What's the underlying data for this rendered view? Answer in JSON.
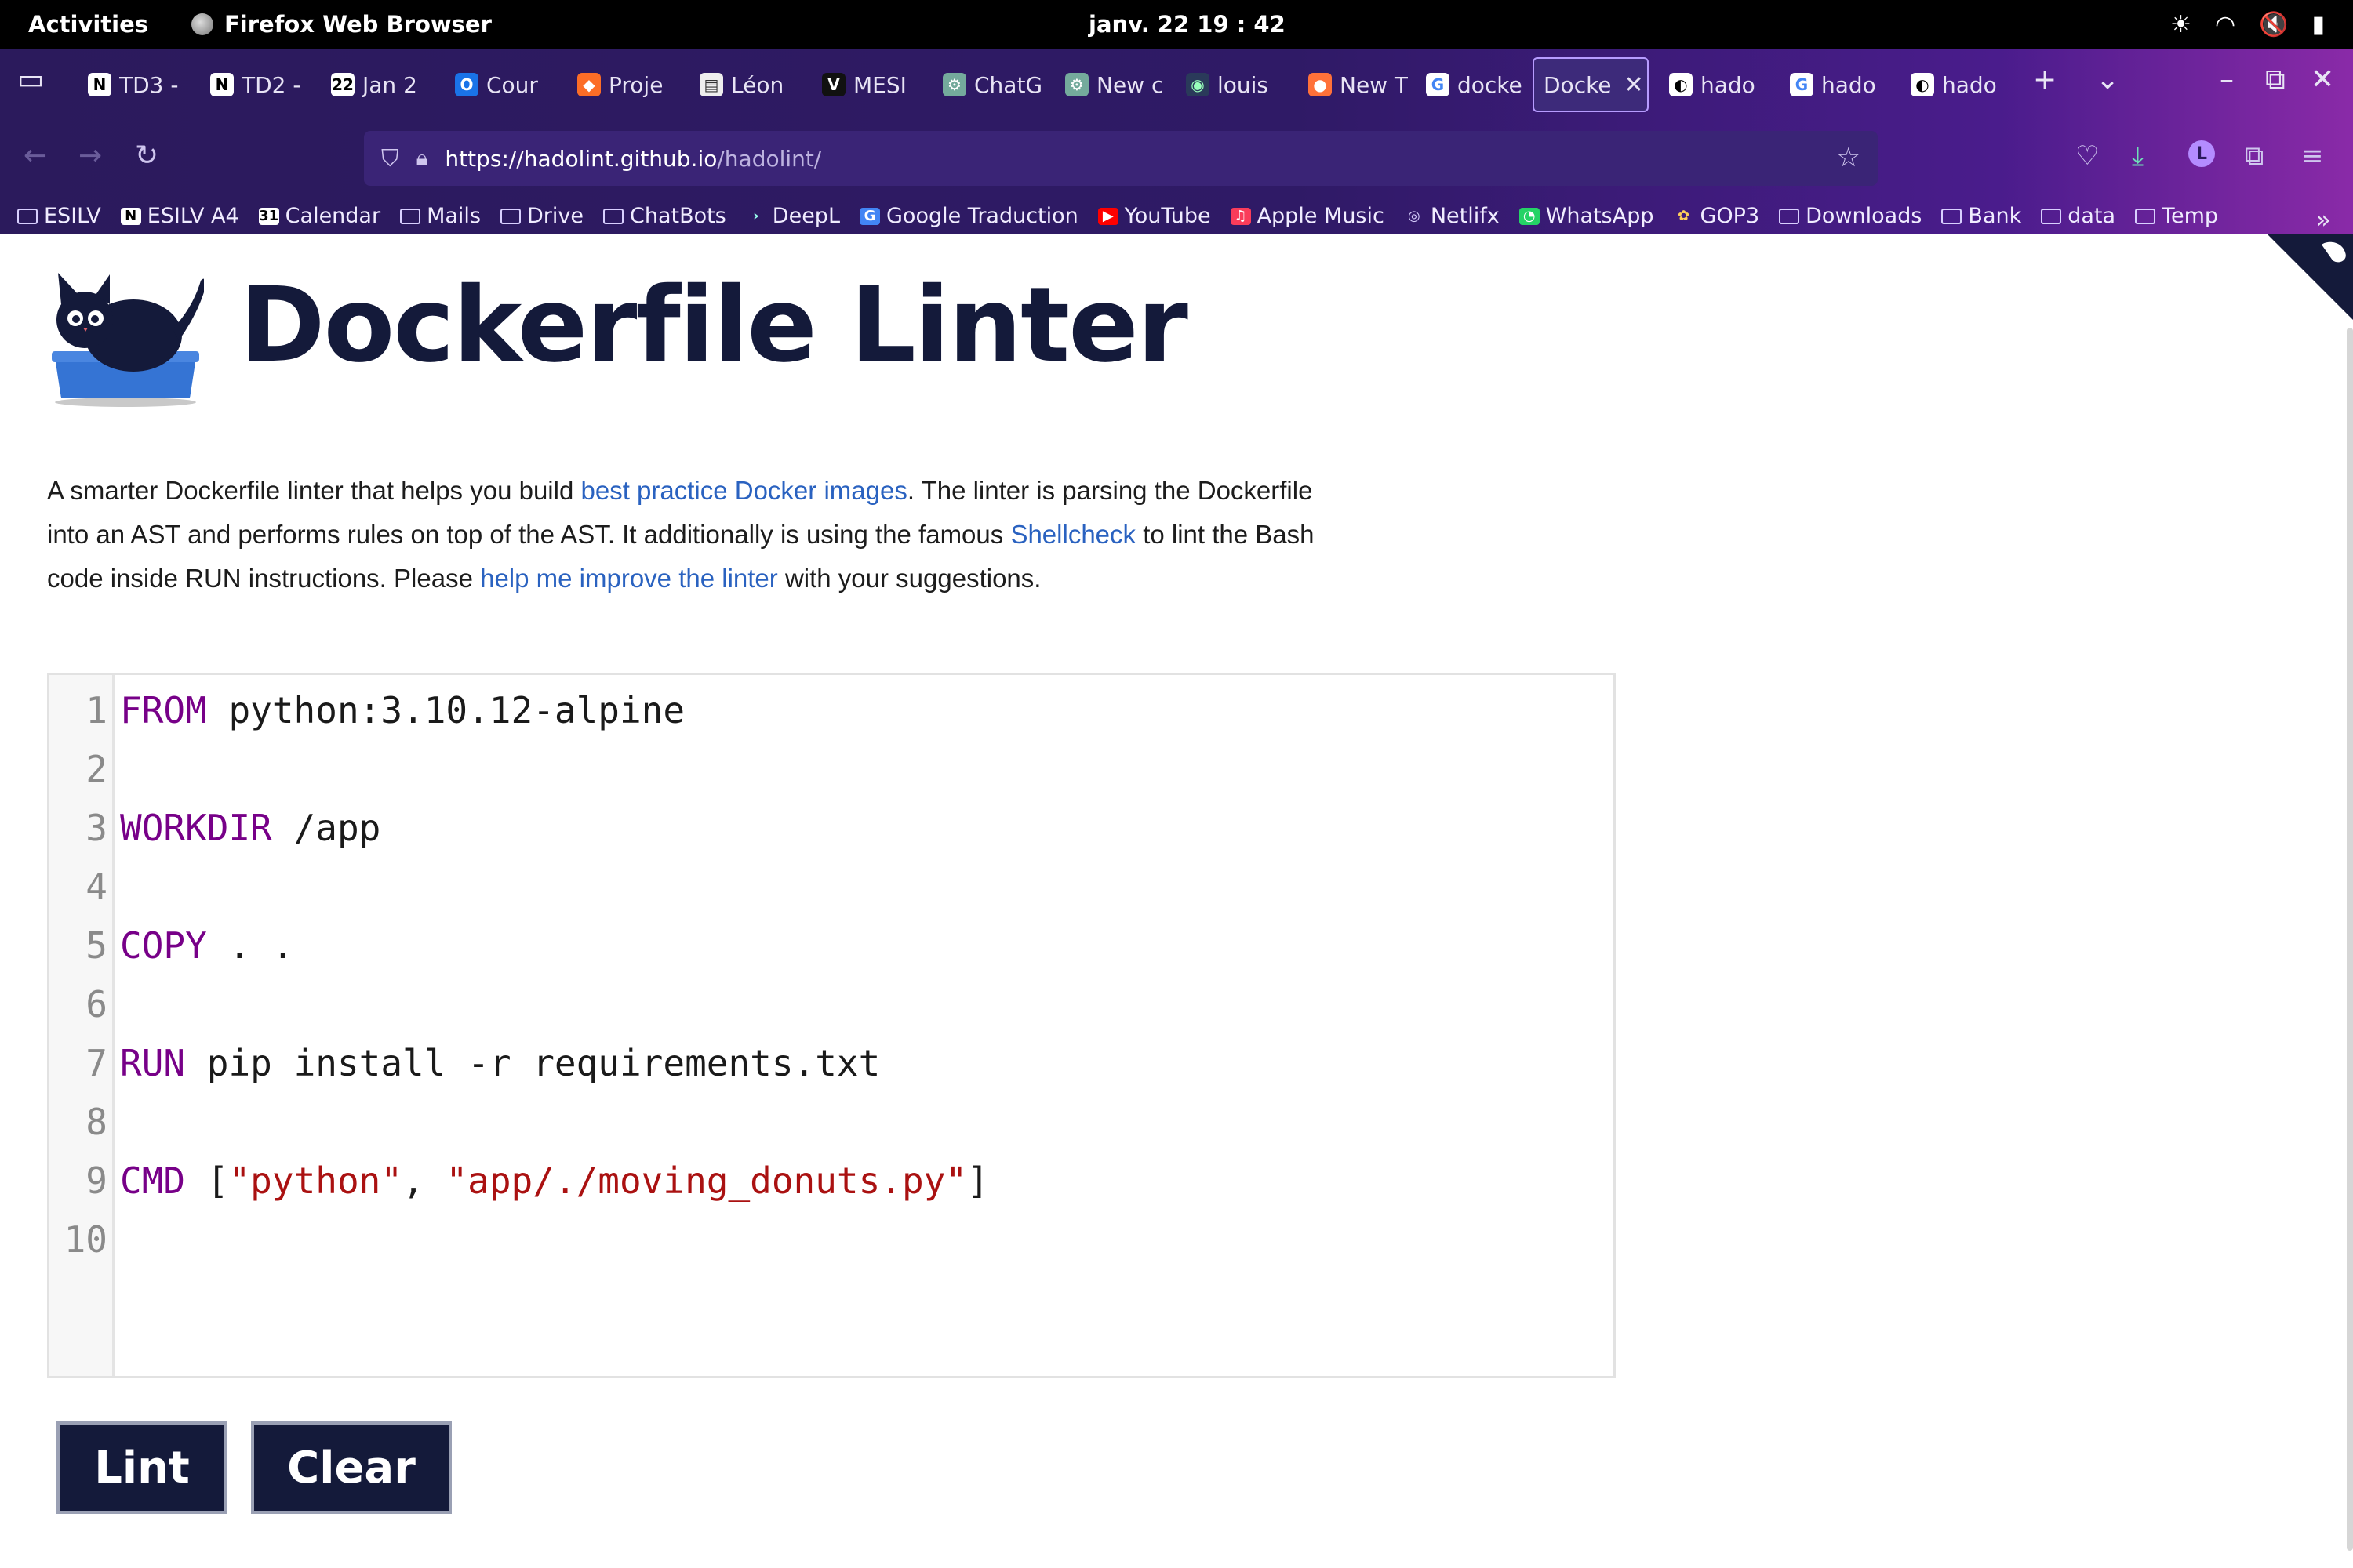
{
  "system_bar": {
    "activities": "Activities",
    "app_name": "Firefox Web Browser",
    "clock": "janv. 22  19 : 42"
  },
  "tabs": [
    {
      "label": "TD3 -",
      "icon": "notion-icon"
    },
    {
      "label": "TD2 -",
      "icon": "notion-icon"
    },
    {
      "label": "Jan 2",
      "icon": "calendar-icon"
    },
    {
      "label": "Cour",
      "icon": "outlook-icon"
    },
    {
      "label": "Proje",
      "icon": "gitlab-icon"
    },
    {
      "label": "Léon",
      "icon": "page-icon"
    },
    {
      "label": "MESI",
      "icon": "v-icon"
    },
    {
      "label": "ChatG",
      "icon": "openai-icon"
    },
    {
      "label": "New c",
      "icon": "openai-icon"
    },
    {
      "label": "louis",
      "icon": "globe-icon"
    },
    {
      "label": "New T",
      "icon": "firefox-icon"
    },
    {
      "label": "docke",
      "icon": "google-icon"
    },
    {
      "label": "Docke",
      "icon": "docker-icon",
      "active": true
    },
    {
      "label": "hado",
      "icon": "github-icon"
    },
    {
      "label": "hado",
      "icon": "google-icon"
    },
    {
      "label": "hado",
      "icon": "github-icon"
    }
  ],
  "url": {
    "host": "https://hadolint.github.io",
    "path": "/hadolint/"
  },
  "bookmarks": [
    {
      "label": "ESILV",
      "icon": "folder-icon"
    },
    {
      "label": "ESILV A4",
      "icon": "notion-icon"
    },
    {
      "label": "Calendar",
      "icon": "calendar-icon"
    },
    {
      "label": "Mails",
      "icon": "folder-icon"
    },
    {
      "label": "Drive",
      "icon": "folder-icon"
    },
    {
      "label": "ChatBots",
      "icon": "folder-icon"
    },
    {
      "label": "DeepL",
      "icon": "deepl-icon"
    },
    {
      "label": "Google Traduction",
      "icon": "translate-icon"
    },
    {
      "label": "YouTube",
      "icon": "youtube-icon"
    },
    {
      "label": "Apple Music",
      "icon": "music-icon"
    },
    {
      "label": "Netlifx",
      "icon": "globe-icon"
    },
    {
      "label": "WhatsApp",
      "icon": "whatsapp-icon"
    },
    {
      "label": "GOP3",
      "icon": "gop3-icon"
    },
    {
      "label": "Downloads",
      "icon": "folder-icon"
    },
    {
      "label": "Bank",
      "icon": "folder-icon"
    },
    {
      "label": "data",
      "icon": "folder-icon"
    },
    {
      "label": "Temp",
      "icon": "folder-icon"
    }
  ],
  "page": {
    "title": "Dockerfile Linter",
    "intro": {
      "t1": "A smarter Dockerfile linter that helps you build ",
      "link1": "best practice Docker images",
      "t2": ". The linter is parsing the Dockerfile into an AST and performs rules on top of the AST. It additionally is using the famous ",
      "link2": "Shellcheck",
      "t3": " to lint the Bash code inside RUN instructions. Please ",
      "link3": "help me improve the linter",
      "t4": " with your suggestions."
    },
    "editor": {
      "lines": [
        {
          "n": "1",
          "kw": "FROM",
          "rest": " python:3.10.12-alpine"
        },
        {
          "n": "2",
          "kw": "",
          "rest": ""
        },
        {
          "n": "3",
          "kw": "WORKDIR",
          "rest": " /app"
        },
        {
          "n": "4",
          "kw": "",
          "rest": ""
        },
        {
          "n": "5",
          "kw": "COPY",
          "rest": " . ."
        },
        {
          "n": "6",
          "kw": "",
          "rest": ""
        },
        {
          "n": "7",
          "kw": "RUN",
          "rest": " pip install -r requirements.txt"
        },
        {
          "n": "8",
          "kw": "",
          "rest": ""
        },
        {
          "n": "9",
          "kw": "CMD",
          "p1": " [",
          "s1": "\"python\"",
          "p2": ", ",
          "s2": "\"app/./moving_donuts.py\"",
          "p3": "]"
        },
        {
          "n": "10",
          "kw": "",
          "rest": ""
        }
      ]
    },
    "buttons": {
      "lint": "Lint",
      "clear": "Clear"
    }
  },
  "colors": {
    "title": "#141a3a",
    "link": "#2a62c0",
    "keyword": "#770088",
    "string": "#aa1111",
    "button_bg": "#141a3a"
  }
}
